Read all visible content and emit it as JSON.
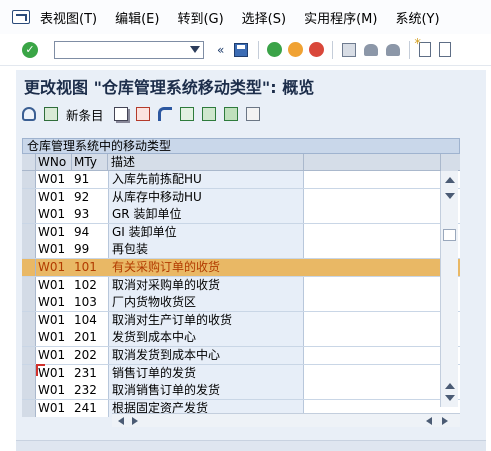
{
  "menu": {
    "items": [
      "表视图(T)",
      "编辑(E)",
      "转到(G)",
      "选择(S)",
      "实用程序(M)",
      "系统(Y)"
    ]
  },
  "toolbar": {
    "command_value": "",
    "prev_glyph": "«"
  },
  "page": {
    "title": "更改视图 \"仓库管理系统移动类型\": 概览"
  },
  "app_toolbar": {
    "new_entries_label": "新条目"
  },
  "table": {
    "title": "仓库管理系统中的移动类型",
    "headers": {
      "wno": "WNo",
      "mty": "MTy",
      "desc": "描述"
    },
    "rows": [
      {
        "wno": "W01",
        "mty": "91",
        "desc": "入库先前拣配HU"
      },
      {
        "wno": "W01",
        "mty": "92",
        "desc": "从库存中移动HU"
      },
      {
        "wno": "W01",
        "mty": "93",
        "desc": "GR 装卸单位"
      },
      {
        "wno": "W01",
        "mty": "94",
        "desc": "GI 装卸单位"
      },
      {
        "wno": "W01",
        "mty": "99",
        "desc": "再包装"
      },
      {
        "wno": "W01",
        "mty": "101",
        "desc": "有关采购订单的收货"
      },
      {
        "wno": "W01",
        "mty": "102",
        "desc": "取消对采购单的收货"
      },
      {
        "wno": "W01",
        "mty": "103",
        "desc": "厂内货物收货区"
      },
      {
        "wno": "W01",
        "mty": "104",
        "desc": "取消对生产订单的收货"
      },
      {
        "wno": "W01",
        "mty": "201",
        "desc": "发货到成本中心"
      },
      {
        "wno": "W01",
        "mty": "202",
        "desc": "取消发货到成本中心"
      },
      {
        "wno": "W01",
        "mty": "231",
        "desc": "销售订单的发货"
      },
      {
        "wno": "W01",
        "mty": "232",
        "desc": "取消销售订单的发货"
      },
      {
        "wno": "W01",
        "mty": "241",
        "desc": "根据固定资产发货"
      }
    ],
    "selected_row": 5
  },
  "colors": {
    "selected_row": "#e9b865",
    "selected_text": "#b23b00",
    "panel_bg": "#e9eff7"
  }
}
